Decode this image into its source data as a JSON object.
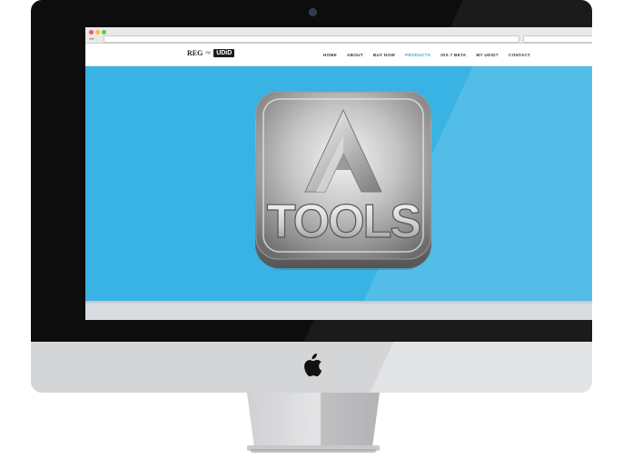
{
  "site": {
    "logo": {
      "prefix": "REG",
      "connector": "my",
      "badge": "UDiD"
    },
    "nav": [
      {
        "label": "HOME",
        "active": false
      },
      {
        "label": "ABOUT",
        "active": false
      },
      {
        "label": "BUY NOW",
        "active": false
      },
      {
        "label": "PRODUCTS",
        "active": true
      },
      {
        "label": "IOS 7 BETA",
        "active": false
      },
      {
        "label": "MY UDID?",
        "active": false
      },
      {
        "label": "CONTACT",
        "active": false
      }
    ]
  },
  "hero": {
    "app_icon_text": "TOOLS",
    "background_color": "#39b3e3"
  },
  "colors": {
    "nav_active": "#2aa9d6",
    "monitor_bezel": "#0d0d0d",
    "chin": "#d4d5d7"
  },
  "icons": [
    "camera-icon",
    "apple-logo-icon",
    "app-tools-icon"
  ]
}
